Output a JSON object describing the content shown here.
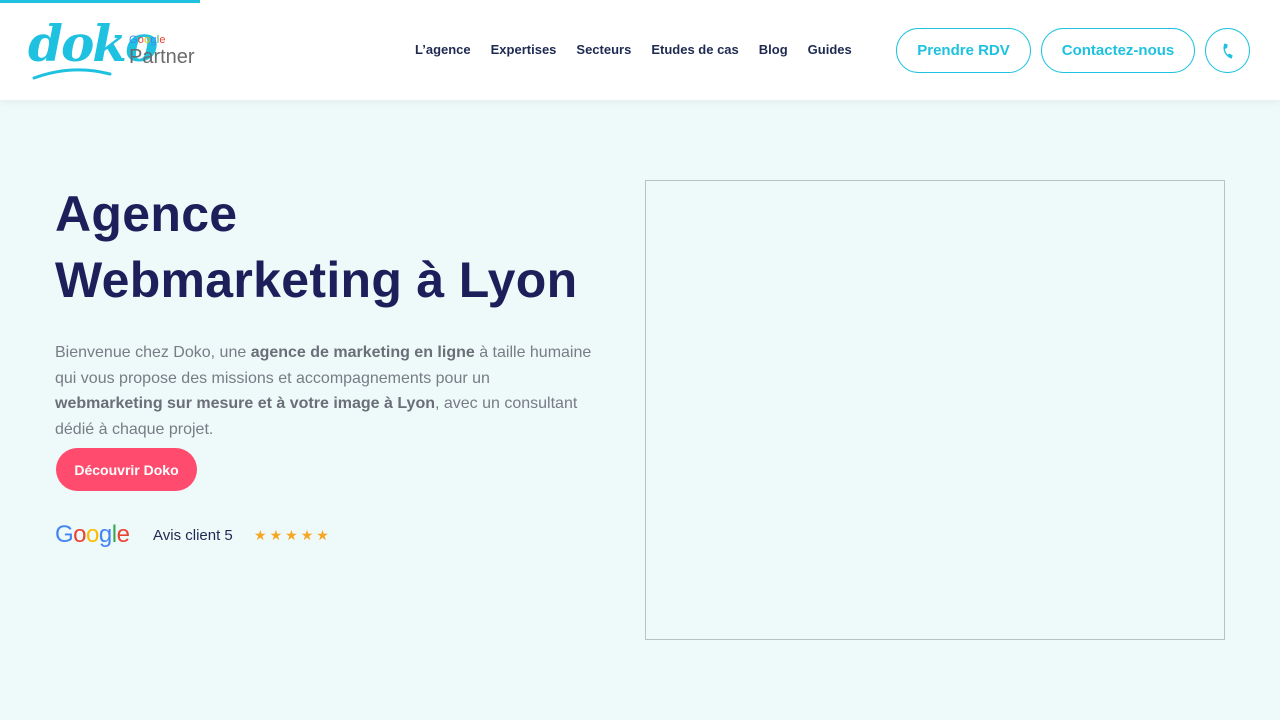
{
  "header": {
    "logo_text": "doko",
    "partner_google": "Google",
    "partner_label": "Partner",
    "nav": [
      "L’agence",
      "Expertises",
      "Secteurs",
      "Etudes de cas",
      "Blog",
      "Guides"
    ],
    "btn_rdv": "Prendre RDV",
    "btn_contact": "Contactez-nous",
    "phone_icon": "phone-icon"
  },
  "hero": {
    "title_line1": "Agence",
    "title_line2": "Webmarketing à Lyon",
    "desc": {
      "p1": "Bienvenue chez Doko, une ",
      "b1": "agence de marketing en ligne",
      "p2": " à taille humaine qui vous propose des missions et accompagnements pour un ",
      "b2": "webmarketing sur mesure et à votre image à Lyon",
      "p3": ", avec un consultant dédié à chaque projet."
    },
    "cta": "Découvrir Doko",
    "rating": {
      "google_letters": [
        "G",
        "o",
        "o",
        "g",
        "l",
        "e"
      ],
      "text": "Avis client 5",
      "stars": [
        "★",
        "★",
        "★",
        "★",
        "★"
      ]
    }
  },
  "colors": {
    "accent": "#1ec2e0",
    "cta": "#ff4b6e",
    "title": "#1c1f5a",
    "background": "#eef9f9",
    "star": "#f6a623",
    "google_blue": "#4285F4",
    "google_red": "#EA4335",
    "google_yellow": "#FBBC05",
    "google_green": "#34A853"
  },
  "page_progress": 0.156
}
